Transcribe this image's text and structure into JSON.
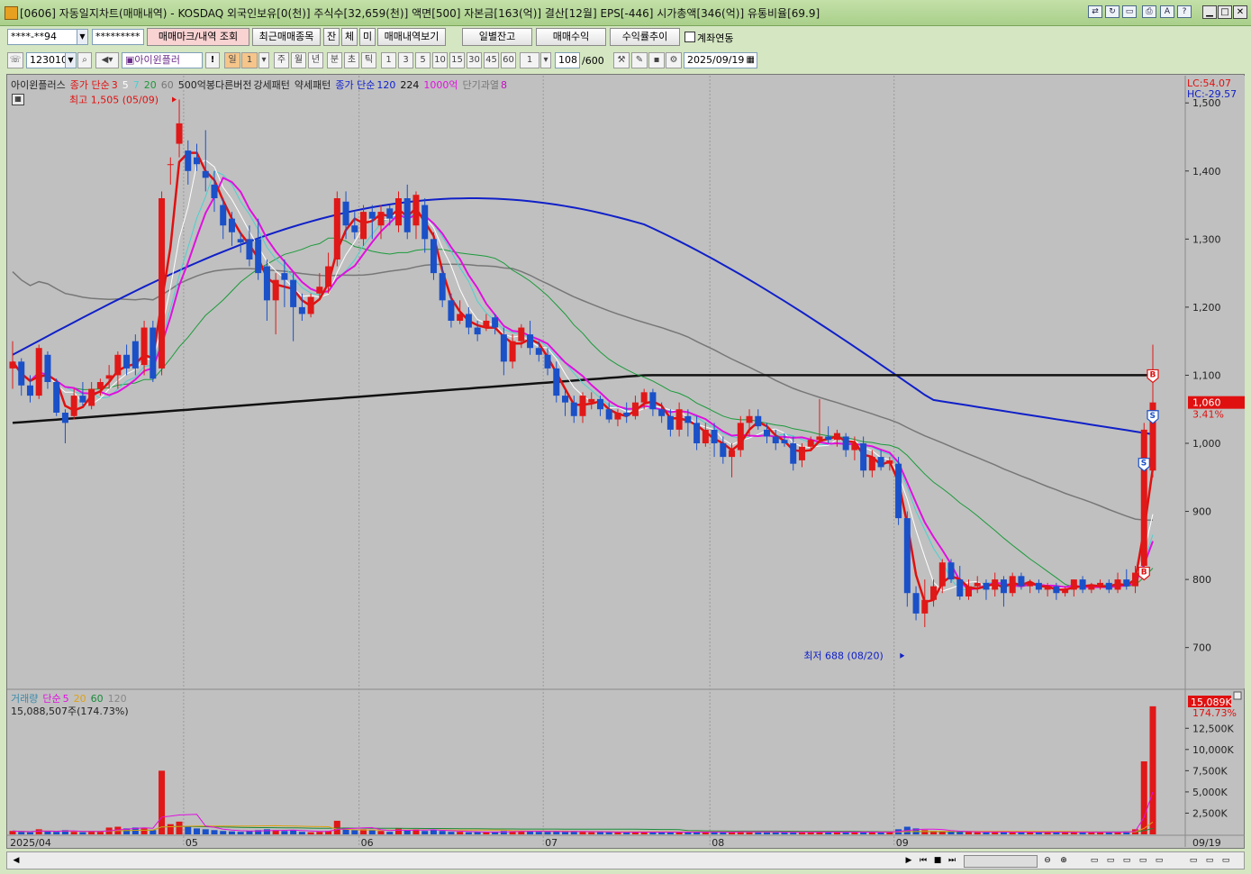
{
  "window": {
    "title": "[0606] 자동일지차트(매매내역) - KOSDAQ 외국인보유[0(천)] 주식수[32,659(천)] 액면[500] 자본금[163(억)] 결산[12월] EPS[-446] 시가총액[346(억)] 유통비율[69.9]"
  },
  "toolbar1": {
    "account": "****-**94",
    "password": "*********",
    "btn_mark": "매매마크/내역 조회",
    "btn_recent": "최근매매종목",
    "btn_jan": "잔",
    "btn_che": "체",
    "btn_mi": "미",
    "btn_history": "매매내역보기",
    "btn_daily_balance": "일별잔고",
    "btn_trade_profit": "매매수익",
    "btn_return_trend": "수익률추이",
    "chk_account_link": "계좌연동"
  },
  "toolbar2": {
    "code": "123010",
    "name": "아이윈플러",
    "period_day": "일",
    "period_num": "1",
    "periods": [
      "주",
      "월",
      "년",
      "분",
      "초",
      "틱"
    ],
    "intervals": [
      "1",
      "3",
      "5",
      "10",
      "15",
      "30",
      "45",
      "60"
    ],
    "interval_sel": "1",
    "count": "108",
    "count_max": "/600",
    "date": "2025/09/19"
  },
  "legend": {
    "name": "아이윈플러스",
    "ma_label": "종가 단순",
    "ma_periods": [
      "3",
      "5",
      "7",
      "20",
      "60"
    ],
    "pattern1": "500억봉다른버전",
    "pattern2": "강세패턴",
    "pattern3": "약세패턴",
    "ma2_label": "종가 단순",
    "ma2_periods": [
      "120",
      "224"
    ],
    "extra1": "1000억",
    "extra2": "단기과열",
    "extra2_val": "8"
  },
  "price_axis": {
    "lc": "LC:54.07",
    "hc": "HC:-29.57",
    "ticks": [
      "1,500",
      "1,400",
      "1,300",
      "1,200",
      "1,100",
      "1,000",
      "900",
      "800",
      "700"
    ],
    "current": "1,060",
    "change": "3.41%"
  },
  "annotations": {
    "high": "최고 1,505 (05/09)",
    "low": "최저 688 (08/20)"
  },
  "volume": {
    "label": "거래량",
    "ma_label": "단순",
    "ma_periods": [
      "5",
      "20",
      "60",
      "120"
    ],
    "summary": "15,088,507주(174.73%)",
    "current": "15,089K",
    "pct": "174.73%",
    "ticks": [
      "12,500K",
      "10,000K",
      "7,500K",
      "5,000K",
      "2,500K"
    ]
  },
  "x_axis": {
    "labels": [
      "2025/04",
      "05",
      "06",
      "07",
      "08",
      "09"
    ],
    "right_label": "09/19"
  },
  "chart_data": {
    "type": "candlestick",
    "ylim": [
      640,
      1540
    ],
    "volume_ylim": [
      0,
      15500
    ],
    "candles": [
      [
        1110,
        1150,
        1080,
        1120,
        400
      ],
      [
        1120,
        1125,
        1070,
        1085,
        300
      ],
      [
        1085,
        1100,
        1060,
        1070,
        250
      ],
      [
        1070,
        1145,
        1065,
        1140,
        600
      ],
      [
        1130,
        1135,
        1080,
        1090,
        350
      ],
      [
        1090,
        1095,
        1040,
        1045,
        300
      ],
      [
        1045,
        1050,
        1000,
        1030,
        500
      ],
      [
        1040,
        1080,
        1035,
        1070,
        300
      ],
      [
        1070,
        1090,
        1055,
        1060,
        250
      ],
      [
        1055,
        1090,
        1050,
        1080,
        400
      ],
      [
        1080,
        1095,
        1070,
        1090,
        300
      ],
      [
        1095,
        1115,
        1080,
        1100,
        800
      ],
      [
        1100,
        1135,
        1080,
        1130,
        900
      ],
      [
        1130,
        1145,
        1100,
        1110,
        700
      ],
      [
        1150,
        1160,
        1100,
        1110,
        800
      ],
      [
        1115,
        1180,
        1100,
        1170,
        700
      ],
      [
        1170,
        1180,
        1090,
        1095,
        500
      ],
      [
        1110,
        1370,
        1100,
        1360,
        7500
      ],
      [
        1410,
        1420,
        1380,
        1410,
        1200
      ],
      [
        1440,
        1505,
        1420,
        1470,
        1500
      ],
      [
        1430,
        1445,
        1380,
        1400,
        900
      ],
      [
        1420,
        1440,
        1400,
        1410,
        700
      ],
      [
        1400,
        1460,
        1370,
        1390,
        600
      ],
      [
        1380,
        1400,
        1340,
        1360,
        500
      ],
      [
        1350,
        1360,
        1300,
        1320,
        400
      ],
      [
        1330,
        1340,
        1290,
        1310,
        350
      ],
      [
        1300,
        1310,
        1280,
        1295,
        300
      ],
      [
        1300,
        1320,
        1260,
        1270,
        400
      ],
      [
        1300,
        1330,
        1240,
        1250,
        500
      ],
      [
        1260,
        1270,
        1180,
        1210,
        600
      ],
      [
        1210,
        1250,
        1160,
        1240,
        500
      ],
      [
        1250,
        1270,
        1200,
        1240,
        400
      ],
      [
        1240,
        1250,
        1150,
        1200,
        500
      ],
      [
        1200,
        1220,
        1180,
        1190,
        300
      ],
      [
        1190,
        1220,
        1185,
        1215,
        250
      ],
      [
        1220,
        1250,
        1210,
        1230,
        300
      ],
      [
        1230,
        1280,
        1220,
        1260,
        400
      ],
      [
        1270,
        1370,
        1260,
        1360,
        1600
      ],
      [
        1355,
        1370,
        1300,
        1320,
        800
      ],
      [
        1320,
        1340,
        1300,
        1310,
        500
      ],
      [
        1300,
        1350,
        1290,
        1340,
        600
      ],
      [
        1340,
        1350,
        1300,
        1330,
        500
      ],
      [
        1320,
        1350,
        1300,
        1340,
        400
      ],
      [
        1345,
        1350,
        1320,
        1330,
        300
      ],
      [
        1320,
        1370,
        1310,
        1360,
        700
      ],
      [
        1360,
        1380,
        1300,
        1310,
        500
      ],
      [
        1320,
        1370,
        1300,
        1365,
        600
      ],
      [
        1350,
        1360,
        1280,
        1300,
        400
      ],
      [
        1300,
        1310,
        1240,
        1250,
        500
      ],
      [
        1250,
        1260,
        1200,
        1210,
        400
      ],
      [
        1210,
        1220,
        1170,
        1180,
        300
      ],
      [
        1180,
        1210,
        1175,
        1190,
        300
      ],
      [
        1190,
        1200,
        1160,
        1170,
        250
      ],
      [
        1170,
        1180,
        1150,
        1160,
        300
      ],
      [
        1170,
        1190,
        1165,
        1180,
        250
      ],
      [
        1185,
        1190,
        1160,
        1170,
        300
      ],
      [
        1160,
        1170,
        1100,
        1120,
        400
      ],
      [
        1120,
        1160,
        1110,
        1150,
        350
      ],
      [
        1150,
        1175,
        1140,
        1170,
        400
      ],
      [
        1160,
        1180,
        1130,
        1140,
        350
      ],
      [
        1140,
        1150,
        1120,
        1130,
        300
      ],
      [
        1130,
        1140,
        1100,
        1110,
        300
      ],
      [
        1110,
        1120,
        1060,
        1070,
        350
      ],
      [
        1070,
        1080,
        1040,
        1060,
        300
      ],
      [
        1060,
        1070,
        1030,
        1040,
        400
      ],
      [
        1040,
        1075,
        1030,
        1070,
        300
      ],
      [
        1060,
        1075,
        1050,
        1065,
        250
      ],
      [
        1065,
        1070,
        1040,
        1050,
        300
      ],
      [
        1050,
        1060,
        1030,
        1035,
        250
      ],
      [
        1035,
        1050,
        1025,
        1045,
        250
      ],
      [
        1045,
        1060,
        1030,
        1040,
        250
      ],
      [
        1040,
        1070,
        1035,
        1060,
        300
      ],
      [
        1060,
        1080,
        1050,
        1075,
        300
      ],
      [
        1075,
        1080,
        1040,
        1050,
        250
      ],
      [
        1050,
        1060,
        1030,
        1040,
        250
      ],
      [
        1040,
        1050,
        1010,
        1020,
        250
      ],
      [
        1020,
        1060,
        1010,
        1050,
        300
      ],
      [
        1040,
        1050,
        1010,
        1030,
        300
      ],
      [
        1030,
        1040,
        990,
        1000,
        250
      ],
      [
        1000,
        1030,
        995,
        1020,
        250
      ],
      [
        1020,
        1030,
        980,
        1000,
        300
      ],
      [
        1000,
        1010,
        970,
        980,
        250
      ],
      [
        980,
        1000,
        950,
        990,
        250
      ],
      [
        990,
        1040,
        980,
        1030,
        400
      ],
      [
        1030,
        1050,
        1010,
        1040,
        300
      ],
      [
        1040,
        1050,
        1020,
        1025,
        250
      ],
      [
        1020,
        1030,
        1000,
        1010,
        250
      ],
      [
        1010,
        1020,
        990,
        1000,
        250
      ],
      [
        1005,
        1015,
        995,
        1000,
        250
      ],
      [
        1000,
        1010,
        960,
        970,
        300
      ],
      [
        975,
        1000,
        965,
        995,
        250
      ],
      [
        995,
        1010,
        990,
        1005,
        250
      ],
      [
        1005,
        1065,
        1000,
        1010,
        300
      ],
      [
        1010,
        1025,
        1000,
        1005,
        250
      ],
      [
        1005,
        1020,
        995,
        1015,
        300
      ],
      [
        1010,
        1015,
        980,
        990,
        250
      ],
      [
        990,
        1010,
        975,
        1000,
        250
      ],
      [
        1000,
        1010,
        950,
        960,
        300
      ],
      [
        960,
        990,
        950,
        980,
        250
      ],
      [
        980,
        990,
        960,
        965,
        250
      ],
      [
        970,
        980,
        960,
        975,
        300
      ],
      [
        970,
        980,
        880,
        890,
        600
      ],
      [
        890,
        900,
        760,
        780,
        900
      ],
      [
        780,
        790,
        740,
        750,
        700
      ],
      [
        750,
        800,
        730,
        770,
        500
      ],
      [
        770,
        800,
        760,
        790,
        400
      ],
      [
        790,
        830,
        780,
        825,
        350
      ],
      [
        825,
        830,
        795,
        800,
        300
      ],
      [
        800,
        820,
        770,
        775,
        300
      ],
      [
        775,
        800,
        770,
        790,
        300
      ],
      [
        790,
        805,
        780,
        795,
        250
      ],
      [
        795,
        800,
        770,
        785,
        250
      ],
      [
        785,
        810,
        775,
        800,
        300
      ],
      [
        800,
        805,
        760,
        780,
        300
      ],
      [
        780,
        810,
        775,
        805,
        250
      ],
      [
        805,
        810,
        785,
        790,
        250
      ],
      [
        790,
        800,
        780,
        795,
        250
      ],
      [
        795,
        800,
        780,
        785,
        250
      ],
      [
        785,
        795,
        775,
        790,
        250
      ],
      [
        790,
        795,
        770,
        780,
        250
      ],
      [
        780,
        790,
        775,
        785,
        250
      ],
      [
        785,
        800,
        775,
        800,
        250
      ],
      [
        800,
        805,
        780,
        785,
        250
      ],
      [
        785,
        795,
        780,
        790,
        250
      ],
      [
        790,
        800,
        785,
        795,
        250
      ],
      [
        795,
        800,
        780,
        785,
        250
      ],
      [
        785,
        810,
        780,
        800,
        300
      ],
      [
        800,
        815,
        785,
        790,
        350
      ],
      [
        790,
        820,
        780,
        810,
        600
      ],
      [
        820,
        1030,
        800,
        1020,
        8600
      ],
      [
        960,
        1145,
        950,
        1060,
        15089
      ]
    ],
    "ma_high_days": 8,
    "ma120_start": 1130,
    "ma224": 1030
  }
}
